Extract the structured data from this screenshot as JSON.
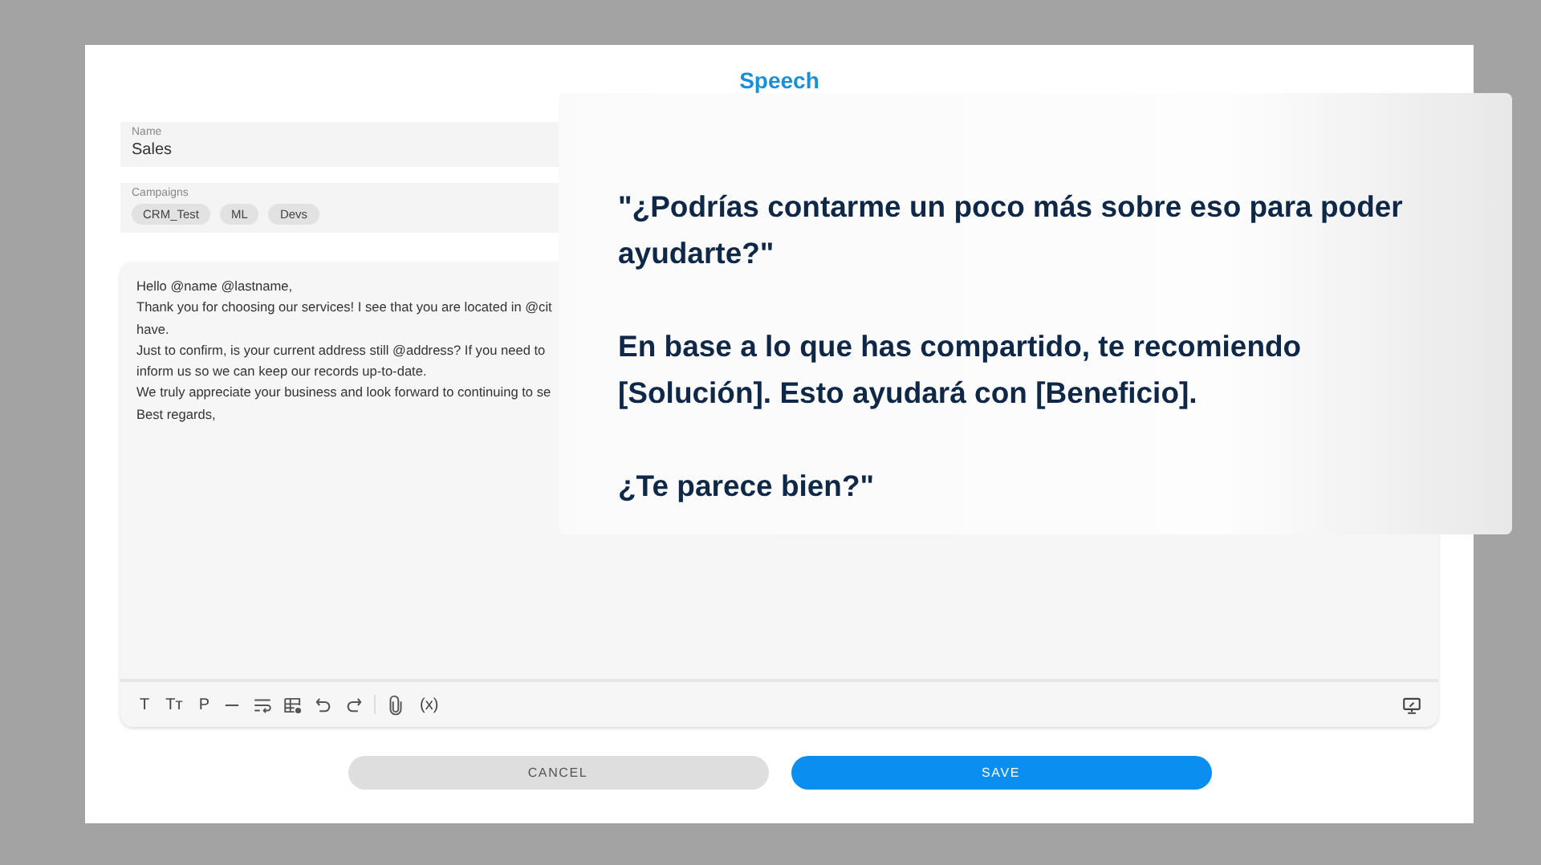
{
  "dialog": {
    "title": "Speech"
  },
  "name_field": {
    "label": "Name",
    "value": "Sales"
  },
  "campaigns": {
    "label": "Campaigns",
    "chips": [
      "CRM_Test",
      "ML",
      "Devs"
    ]
  },
  "editor": {
    "lines": [
      "Hello @name @lastname,",
      "Thank you for choosing our services! I see that you are located in @cit",
      "have.",
      "Just to confirm, is your current address still @address? If you need to",
      "inform us so we can keep our records up-to-date.",
      "We truly appreciate your business and look forward to continuing to se",
      "Best regards,"
    ],
    "toolbar": [
      {
        "kind": "text",
        "label": "T"
      },
      {
        "kind": "text",
        "label": "Tт"
      },
      {
        "kind": "text",
        "label": "P"
      },
      {
        "kind": "dash"
      },
      {
        "kind": "wrap"
      },
      {
        "kind": "table"
      },
      {
        "kind": "undo"
      },
      {
        "kind": "redo"
      },
      {
        "kind": "divider"
      },
      {
        "kind": "attach"
      },
      {
        "kind": "text",
        "label": "(x)"
      }
    ],
    "toolbar_right": [
      {
        "kind": "monitor"
      }
    ]
  },
  "buttons": [
    {
      "label": "CANCEL",
      "kind": "secondary"
    },
    {
      "label": "SAVE",
      "kind": "primary"
    }
  ],
  "callout": {
    "paragraphs": [
      "\"¿Podrías contarme un poco más sobre eso para poder ayudarte?\"",
      "En base a lo que has compartido, te recomiendo [Solución]. Esto ayudará con [Beneficio].",
      "¿Te parece bien?\""
    ]
  }
}
